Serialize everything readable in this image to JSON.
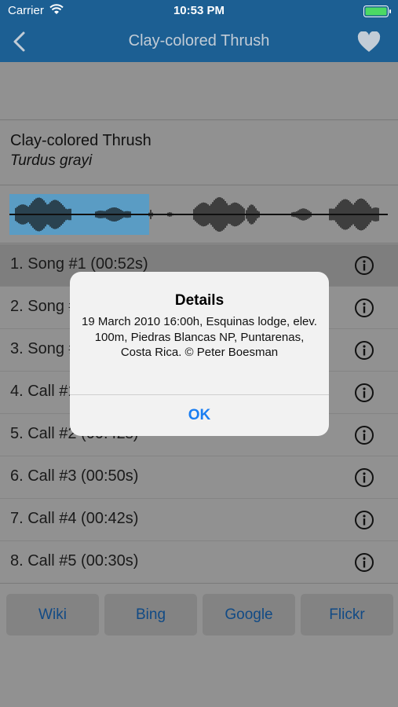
{
  "status_bar": {
    "carrier": "Carrier",
    "time": "10:53 PM"
  },
  "nav": {
    "title": "Clay-colored Thrush"
  },
  "species": {
    "common_name": "Clay-colored Thrush",
    "scientific_name": "Turdus grayi"
  },
  "recordings": [
    {
      "label": "1. Song #1 (00:52s)",
      "selected": true
    },
    {
      "label": "2. Song #2 (00:43s)",
      "selected": false
    },
    {
      "label": "3. Song #3 (00:48s)",
      "selected": false
    },
    {
      "label": "4. Call #1 (00:26s)",
      "selected": false
    },
    {
      "label": "5. Call #2 (00:42s)",
      "selected": false
    },
    {
      "label": "6. Call #3 (00:50s)",
      "selected": false
    },
    {
      "label": "7. Call #4 (00:42s)",
      "selected": false
    },
    {
      "label": "8. Call #5 (00:30s)",
      "selected": false
    }
  ],
  "search_buttons": [
    "Wiki",
    "Bing",
    "Google",
    "Flickr"
  ],
  "waveform": {
    "played_fraction": 0.37
  },
  "alert": {
    "title": "Details",
    "message": "19 March 2010 16:00h, Esquinas lodge, elev. 100m, Piedras Blancas NP, Puntarenas, Costa Rica. © Peter Boesman",
    "ok_label": "OK"
  },
  "colors": {
    "nav_bar": "#1c5f93",
    "alert_button": "#1a7ef2",
    "search_button_text": "#114a85"
  }
}
